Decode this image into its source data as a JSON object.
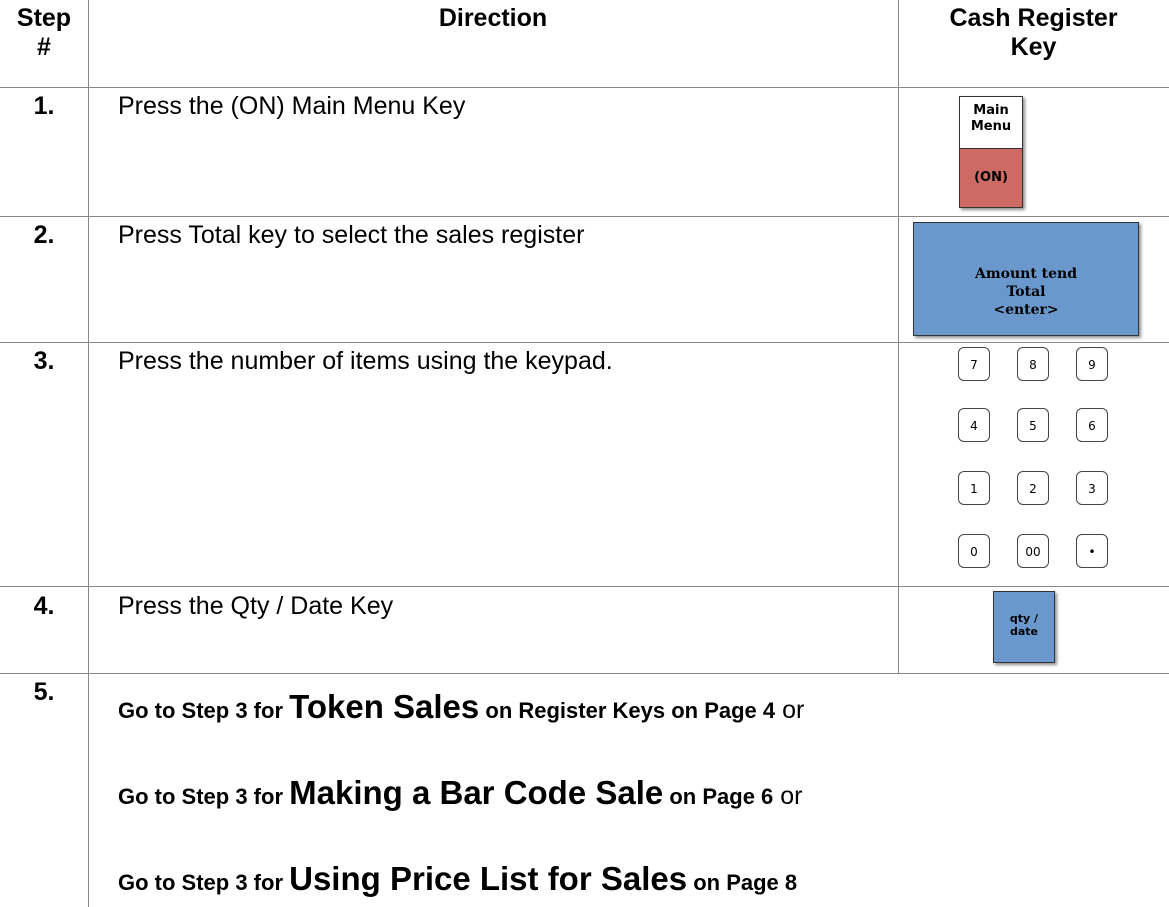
{
  "header": {
    "step_line1": "Step",
    "step_line2": "#",
    "direction": "Direction",
    "key_line1": "Cash Register",
    "key_line2": "Key"
  },
  "rows": [
    {
      "num": "1.",
      "direction": "Press the (ON) Main Menu Key"
    },
    {
      "num": "2.",
      "direction": "Press Total key to select the sales register"
    },
    {
      "num": "3.",
      "direction": "Press the number of items using the keypad."
    },
    {
      "num": "4.",
      "direction": "Press the Qty / Date Key"
    },
    {
      "num": "5."
    }
  ],
  "keys": {
    "main_menu": {
      "top_line1": "Main",
      "top_line2": "Menu",
      "bottom": "(ON)"
    },
    "total": {
      "line1": "Amount tend",
      "line2": "Total",
      "line3": "<enter>"
    },
    "keypad": [
      "7",
      "8",
      "9",
      "4",
      "5",
      "6",
      "1",
      "2",
      "3",
      "0",
      "00",
      "•"
    ],
    "qty_date": {
      "line1": "qty /",
      "line2": "date"
    }
  },
  "step5": [
    {
      "pre": "Go to Step 3 for ",
      "big": "Token Sales",
      "post": " on Register Keys on Page 4",
      "tail": " or"
    },
    {
      "pre": "Go to Step 3 for ",
      "big": "Making a Bar Code Sale",
      "post": " on Page 6",
      "tail": " or"
    },
    {
      "pre": "Go to Step 3 for ",
      "big": "Using Price List for Sales",
      "post": " on Page 8",
      "tail": ""
    }
  ],
  "colors": {
    "main_menu_on": "#cd6a63",
    "blue_key": "#6a98cc",
    "grid_line": "#888888"
  }
}
